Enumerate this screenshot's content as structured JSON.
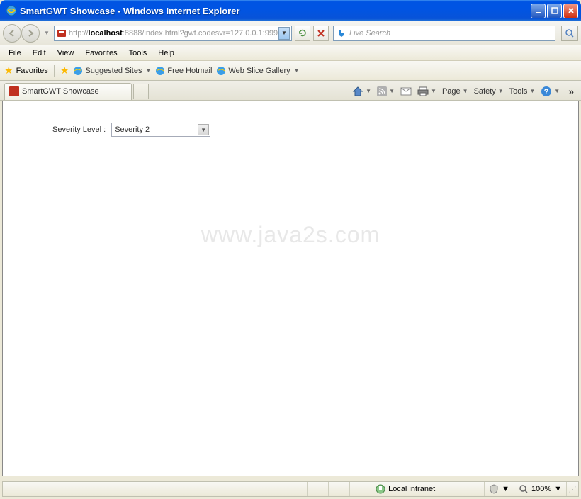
{
  "title": "SmartGWT Showcase - Windows Internet Explorer",
  "address": {
    "prefix": "http://",
    "host": "localhost",
    "port": ":8888",
    "path": "/index.html?gwt.codesvr=127.0.0.1:999"
  },
  "search_placeholder": "Live Search",
  "menu": [
    "File",
    "Edit",
    "View",
    "Favorites",
    "Tools",
    "Help"
  ],
  "favbar": {
    "label": "Favorites",
    "items": [
      "Suggested Sites",
      "Free Hotmail",
      "Web Slice Gallery"
    ]
  },
  "tab": "SmartGWT Showcase",
  "toolbar_right": [
    "Page",
    "Safety",
    "Tools"
  ],
  "form": {
    "label": "Severity Level :",
    "value": "Severity 2"
  },
  "watermark": "www.java2s.com",
  "status": {
    "zone": "Local intranet",
    "zoom": "100%"
  }
}
